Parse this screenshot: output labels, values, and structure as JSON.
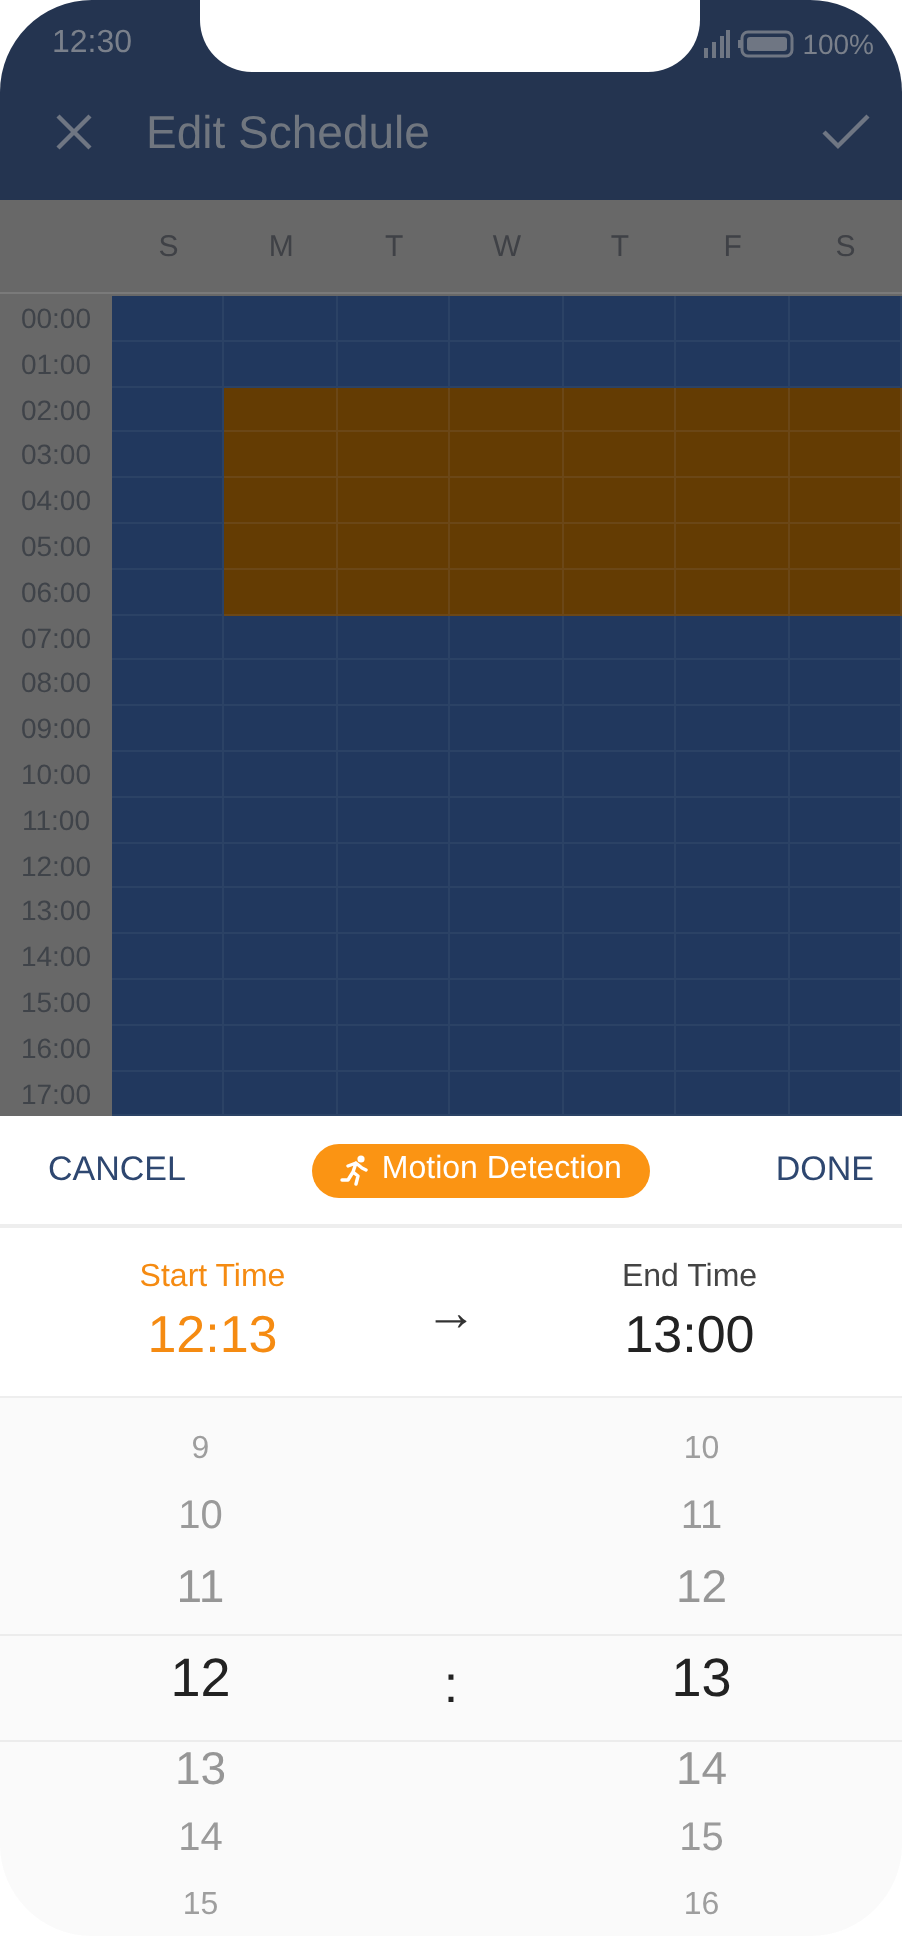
{
  "status_bar": {
    "time": "12:30",
    "battery": "100%"
  },
  "app_bar": {
    "title": "Edit Schedule"
  },
  "schedule": {
    "days": [
      "S",
      "M",
      "T",
      "W",
      "T",
      "F",
      "S"
    ],
    "hours": [
      {
        "label": "00:00",
        "cells": [
          false,
          false,
          false,
          false,
          false,
          false,
          false
        ]
      },
      {
        "label": "01:00",
        "cells": [
          false,
          false,
          false,
          false,
          false,
          false,
          false
        ]
      },
      {
        "label": "02:00",
        "cells": [
          false,
          true,
          true,
          true,
          true,
          true,
          true
        ]
      },
      {
        "label": "03:00",
        "cells": [
          false,
          true,
          true,
          true,
          true,
          true,
          true
        ]
      },
      {
        "label": "04:00",
        "cells": [
          false,
          true,
          true,
          true,
          true,
          true,
          true
        ]
      },
      {
        "label": "05:00",
        "cells": [
          false,
          true,
          true,
          true,
          true,
          true,
          true
        ]
      },
      {
        "label": "06:00",
        "cells": [
          false,
          true,
          true,
          true,
          true,
          true,
          true
        ]
      },
      {
        "label": "07:00",
        "cells": [
          false,
          false,
          false,
          false,
          false,
          false,
          false
        ]
      },
      {
        "label": "08:00",
        "cells": [
          false,
          false,
          false,
          false,
          false,
          false,
          false
        ]
      },
      {
        "label": "09:00",
        "cells": [
          false,
          false,
          false,
          false,
          false,
          false,
          false
        ]
      },
      {
        "label": "10:00",
        "cells": [
          false,
          false,
          false,
          false,
          false,
          false,
          false
        ]
      },
      {
        "label": "11:00",
        "cells": [
          false,
          false,
          false,
          false,
          false,
          false,
          false
        ]
      },
      {
        "label": "12:00",
        "cells": [
          false,
          false,
          false,
          false,
          false,
          false,
          false
        ]
      },
      {
        "label": "13:00",
        "cells": [
          false,
          false,
          false,
          false,
          false,
          false,
          false
        ]
      },
      {
        "label": "14:00",
        "cells": [
          false,
          false,
          false,
          false,
          false,
          false,
          false
        ]
      },
      {
        "label": "15:00",
        "cells": [
          false,
          false,
          false,
          false,
          false,
          false,
          false
        ]
      },
      {
        "label": "16:00",
        "cells": [
          false,
          false,
          false,
          false,
          false,
          false,
          false
        ]
      },
      {
        "label": "17:00",
        "cells": [
          false,
          false,
          false,
          false,
          false,
          false,
          false
        ]
      }
    ]
  },
  "sheet": {
    "cancel": "CANCEL",
    "mode": "Motion Detection",
    "done": "DONE",
    "start": {
      "label": "Start Time",
      "value": "12:13",
      "selected": true
    },
    "arrow": "→",
    "end": {
      "label": "End Time",
      "value": "13:00",
      "selected": false
    },
    "picker": {
      "separator": ":",
      "hours": [
        {
          "text": "9",
          "selected": false
        },
        {
          "text": "10",
          "selected": false
        },
        {
          "text": "11",
          "selected": false
        },
        {
          "text": "12",
          "selected": true
        },
        {
          "text": "13",
          "selected": false
        },
        {
          "text": "14",
          "selected": false
        },
        {
          "text": "15",
          "selected": false
        }
      ],
      "minutes": [
        {
          "text": "10",
          "selected": false
        },
        {
          "text": "11",
          "selected": false
        },
        {
          "text": "12",
          "selected": false
        },
        {
          "text": "13",
          "selected": true
        },
        {
          "text": "14",
          "selected": false
        },
        {
          "text": "15",
          "selected": false
        },
        {
          "text": "16",
          "selected": false
        }
      ]
    }
  }
}
